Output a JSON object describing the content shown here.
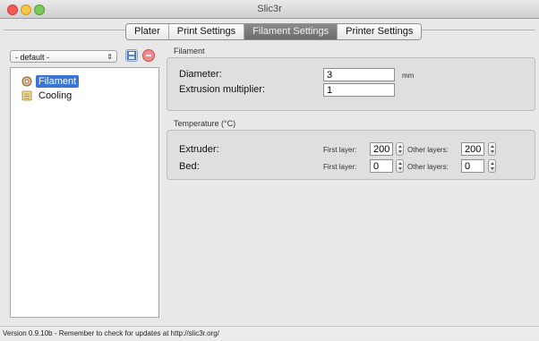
{
  "window": {
    "title": "Slic3r"
  },
  "tabs": [
    {
      "label": "Plater"
    },
    {
      "label": "Print Settings"
    },
    {
      "label": "Filament Settings"
    },
    {
      "label": "Printer Settings"
    }
  ],
  "preset": {
    "selected": "- default -"
  },
  "tree": {
    "items": [
      {
        "label": "Filament",
        "icon": "spool-icon",
        "selected": true
      },
      {
        "label": "Cooling",
        "icon": "fan-icon",
        "selected": false
      }
    ]
  },
  "filament_group": {
    "title": "Filament",
    "diameter": {
      "label": "Diameter:",
      "value": "3",
      "unit": "mm"
    },
    "extrusion": {
      "label": "Extrusion multiplier:",
      "value": "1"
    }
  },
  "temperature_group": {
    "title": "Temperature (°C)",
    "extruder": {
      "label": "Extruder:",
      "first_label": "First layer:",
      "first_value": "200",
      "other_label": "Other layers:",
      "other_value": "200"
    },
    "bed": {
      "label": "Bed:",
      "first_label": "First layer:",
      "first_value": "0",
      "other_label": "Other layers:",
      "other_value": "0"
    }
  },
  "status": {
    "text": "Version 0.9.10b - Remember to check for updates at http://slic3r.org/"
  },
  "colors": {
    "selection": "#3875d7",
    "active_tab": "#7a7a7a"
  }
}
